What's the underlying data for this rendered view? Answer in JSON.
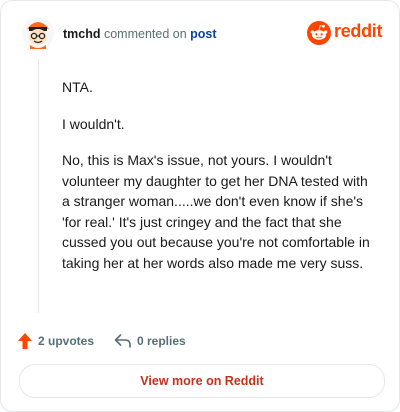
{
  "header": {
    "username": "tmchd",
    "action": "commented on",
    "post_link": "post",
    "brand": "reddit"
  },
  "comment": {
    "paragraphs": [
      "NTA.",
      "I wouldn't.",
      "No, this is Max's issue, not yours. I wouldn't volunteer my daughter to get her DNA tested with a stranger woman.....we don't even know if she's 'for real.' It's just cringey and the fact that she cussed you out because you're not comfortable in taking her at her words also made me very suss."
    ]
  },
  "actions": {
    "upvotes": "2 upvotes",
    "replies": "0 replies"
  },
  "cta": {
    "label": "View more on Reddit"
  },
  "colors": {
    "brand": "#ff4500",
    "link": "#0a449b",
    "cta_text": "#c5311a"
  },
  "icons": [
    "avatar",
    "reddit-logo-icon",
    "upvote-icon",
    "reply-icon"
  ]
}
